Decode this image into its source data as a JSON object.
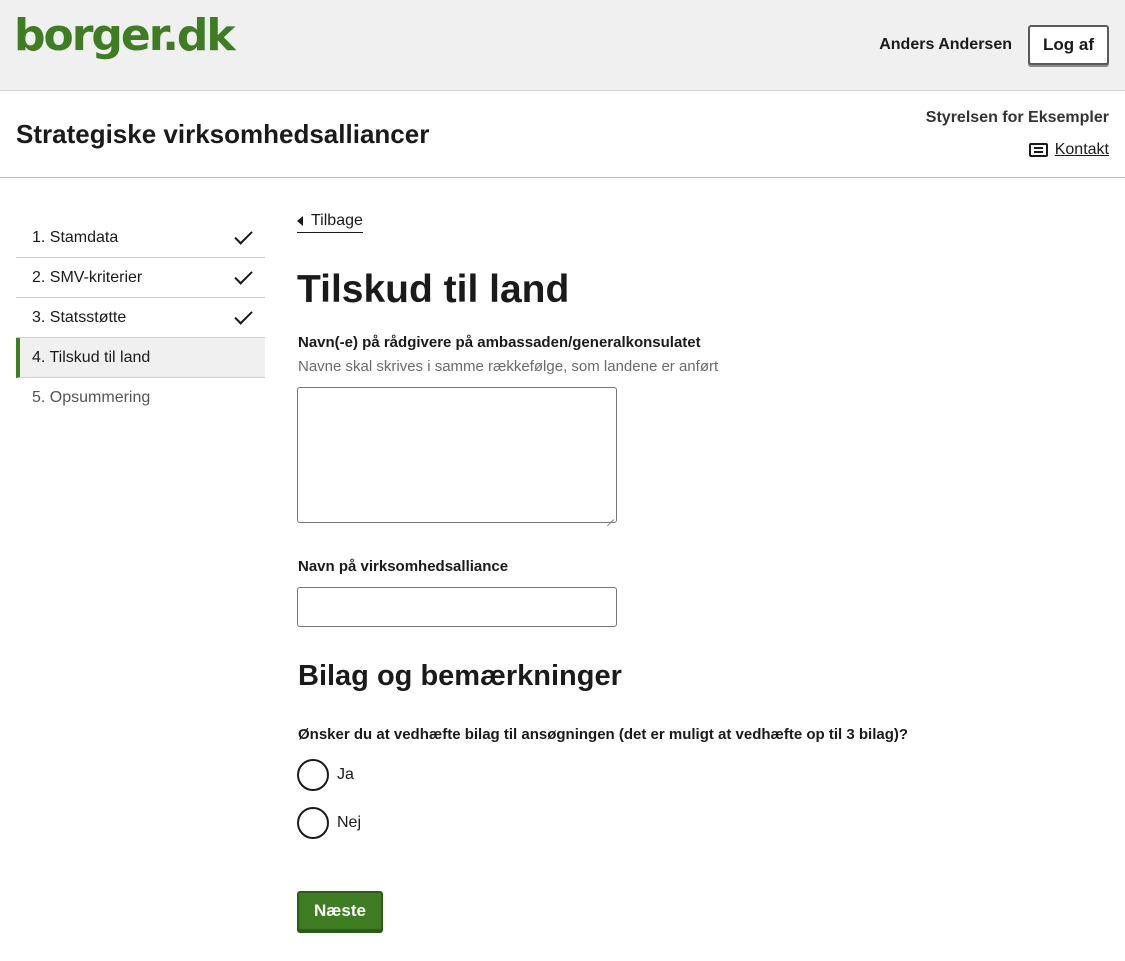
{
  "header": {
    "logo_text": "borger.dk",
    "user_name": "Anders Andersen",
    "logout_label": "Log af"
  },
  "service": {
    "title": "Strategiske virksomhedsalliancer",
    "authority": "Styrelsen for Eksempler",
    "contact_label": "Kontakt",
    "contact_icon": "contact-card-icon"
  },
  "sidenav": {
    "items": [
      {
        "label": "1. Stamdata",
        "status": "completed"
      },
      {
        "label": "2. SMV-kriterier",
        "status": "completed"
      },
      {
        "label": "3. Statsstøtte",
        "status": "completed"
      },
      {
        "label": "4. Tilskud til land",
        "status": "current"
      },
      {
        "label": "5. Opsummering",
        "status": "upcoming"
      }
    ]
  },
  "main": {
    "back_label": "Tilbage",
    "page_title": "Tilskud til land",
    "field_advisors": {
      "label": "Navn(-e) på rådgivere på ambassaden/generalkonsulatet",
      "hint": "Navne skal skrives i samme rækkefølge, som landene er anført",
      "value": ""
    },
    "field_alliance": {
      "label": "Navn på virksomhedsalliance",
      "value": ""
    },
    "section_title": "Bilag og bemærkninger",
    "attachments_question": "Ønsker du at vedhæfte bilag til ansøgningen (det er muligt at vedhæfte op til 3 bilag)?",
    "radio_yes": "Ja",
    "radio_no": "Nej",
    "next_label": "Næste"
  },
  "colors": {
    "brand_green": "#3f7d23",
    "header_bg": "#f0f0f0"
  }
}
